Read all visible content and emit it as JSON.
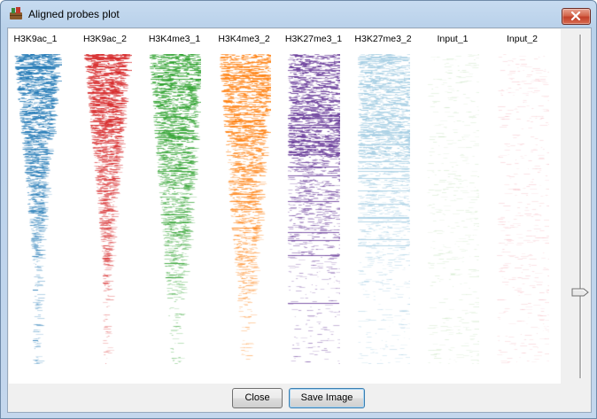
{
  "window": {
    "title": "Aligned probes plot"
  },
  "tracks": [
    {
      "label": "H3K9ac_1",
      "color": "#1f77b4",
      "profile": "peak"
    },
    {
      "label": "H3K9ac_2",
      "color": "#d62728",
      "profile": "peak"
    },
    {
      "label": "H3K4me3_1",
      "color": "#2ca02c",
      "profile": "broad"
    },
    {
      "label": "H3K4me3_2",
      "color": "#ff7f0e",
      "profile": "broad"
    },
    {
      "label": "H3K27me3_1",
      "color": "#6a3d9a",
      "profile": "uniform"
    },
    {
      "label": "H3K27me3_2",
      "color": "#a6cee3",
      "profile": "uniform"
    },
    {
      "label": "Input_1",
      "color": "#c7e3bf",
      "profile": "flat"
    },
    {
      "label": "Input_2",
      "color": "#f6b8c0",
      "profile": "flat"
    }
  ],
  "buttons": {
    "close": "Close",
    "save_image": "Save Image"
  },
  "slider": {
    "value": 0.75
  },
  "icons": {
    "app": "app-icon",
    "window_close": "close-icon"
  }
}
